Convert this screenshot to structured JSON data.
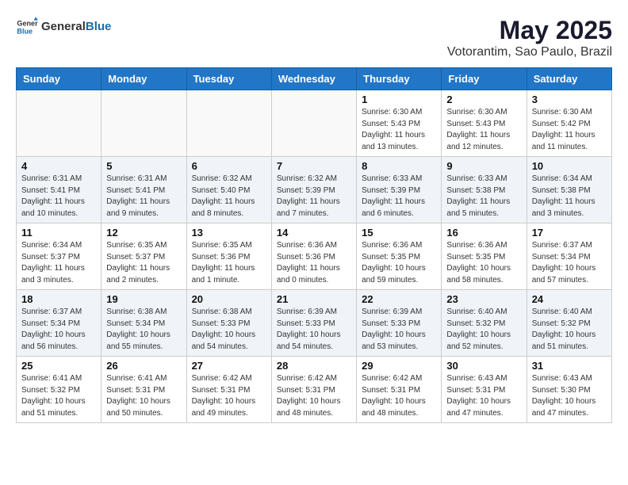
{
  "header": {
    "logo_general": "General",
    "logo_blue": "Blue",
    "title": "May 2025",
    "subtitle": "Votorantim, Sao Paulo, Brazil"
  },
  "weekdays": [
    "Sunday",
    "Monday",
    "Tuesday",
    "Wednesday",
    "Thursday",
    "Friday",
    "Saturday"
  ],
  "weeks": [
    [
      {
        "day": "",
        "info": ""
      },
      {
        "day": "",
        "info": ""
      },
      {
        "day": "",
        "info": ""
      },
      {
        "day": "",
        "info": ""
      },
      {
        "day": "1",
        "info": "Sunrise: 6:30 AM\nSunset: 5:43 PM\nDaylight: 11 hours\nand 13 minutes."
      },
      {
        "day": "2",
        "info": "Sunrise: 6:30 AM\nSunset: 5:43 PM\nDaylight: 11 hours\nand 12 minutes."
      },
      {
        "day": "3",
        "info": "Sunrise: 6:30 AM\nSunset: 5:42 PM\nDaylight: 11 hours\nand 11 minutes."
      }
    ],
    [
      {
        "day": "4",
        "info": "Sunrise: 6:31 AM\nSunset: 5:41 PM\nDaylight: 11 hours\nand 10 minutes."
      },
      {
        "day": "5",
        "info": "Sunrise: 6:31 AM\nSunset: 5:41 PM\nDaylight: 11 hours\nand 9 minutes."
      },
      {
        "day": "6",
        "info": "Sunrise: 6:32 AM\nSunset: 5:40 PM\nDaylight: 11 hours\nand 8 minutes."
      },
      {
        "day": "7",
        "info": "Sunrise: 6:32 AM\nSunset: 5:39 PM\nDaylight: 11 hours\nand 7 minutes."
      },
      {
        "day": "8",
        "info": "Sunrise: 6:33 AM\nSunset: 5:39 PM\nDaylight: 11 hours\nand 6 minutes."
      },
      {
        "day": "9",
        "info": "Sunrise: 6:33 AM\nSunset: 5:38 PM\nDaylight: 11 hours\nand 5 minutes."
      },
      {
        "day": "10",
        "info": "Sunrise: 6:34 AM\nSunset: 5:38 PM\nDaylight: 11 hours\nand 3 minutes."
      }
    ],
    [
      {
        "day": "11",
        "info": "Sunrise: 6:34 AM\nSunset: 5:37 PM\nDaylight: 11 hours\nand 3 minutes."
      },
      {
        "day": "12",
        "info": "Sunrise: 6:35 AM\nSunset: 5:37 PM\nDaylight: 11 hours\nand 2 minutes."
      },
      {
        "day": "13",
        "info": "Sunrise: 6:35 AM\nSunset: 5:36 PM\nDaylight: 11 hours\nand 1 minute."
      },
      {
        "day": "14",
        "info": "Sunrise: 6:36 AM\nSunset: 5:36 PM\nDaylight: 11 hours\nand 0 minutes."
      },
      {
        "day": "15",
        "info": "Sunrise: 6:36 AM\nSunset: 5:35 PM\nDaylight: 10 hours\nand 59 minutes."
      },
      {
        "day": "16",
        "info": "Sunrise: 6:36 AM\nSunset: 5:35 PM\nDaylight: 10 hours\nand 58 minutes."
      },
      {
        "day": "17",
        "info": "Sunrise: 6:37 AM\nSunset: 5:34 PM\nDaylight: 10 hours\nand 57 minutes."
      }
    ],
    [
      {
        "day": "18",
        "info": "Sunrise: 6:37 AM\nSunset: 5:34 PM\nDaylight: 10 hours\nand 56 minutes."
      },
      {
        "day": "19",
        "info": "Sunrise: 6:38 AM\nSunset: 5:34 PM\nDaylight: 10 hours\nand 55 minutes."
      },
      {
        "day": "20",
        "info": "Sunrise: 6:38 AM\nSunset: 5:33 PM\nDaylight: 10 hours\nand 54 minutes."
      },
      {
        "day": "21",
        "info": "Sunrise: 6:39 AM\nSunset: 5:33 PM\nDaylight: 10 hours\nand 54 minutes."
      },
      {
        "day": "22",
        "info": "Sunrise: 6:39 AM\nSunset: 5:33 PM\nDaylight: 10 hours\nand 53 minutes."
      },
      {
        "day": "23",
        "info": "Sunrise: 6:40 AM\nSunset: 5:32 PM\nDaylight: 10 hours\nand 52 minutes."
      },
      {
        "day": "24",
        "info": "Sunrise: 6:40 AM\nSunset: 5:32 PM\nDaylight: 10 hours\nand 51 minutes."
      }
    ],
    [
      {
        "day": "25",
        "info": "Sunrise: 6:41 AM\nSunset: 5:32 PM\nDaylight: 10 hours\nand 51 minutes."
      },
      {
        "day": "26",
        "info": "Sunrise: 6:41 AM\nSunset: 5:31 PM\nDaylight: 10 hours\nand 50 minutes."
      },
      {
        "day": "27",
        "info": "Sunrise: 6:42 AM\nSunset: 5:31 PM\nDaylight: 10 hours\nand 49 minutes."
      },
      {
        "day": "28",
        "info": "Sunrise: 6:42 AM\nSunset: 5:31 PM\nDaylight: 10 hours\nand 48 minutes."
      },
      {
        "day": "29",
        "info": "Sunrise: 6:42 AM\nSunset: 5:31 PM\nDaylight: 10 hours\nand 48 minutes."
      },
      {
        "day": "30",
        "info": "Sunrise: 6:43 AM\nSunset: 5:31 PM\nDaylight: 10 hours\nand 47 minutes."
      },
      {
        "day": "31",
        "info": "Sunrise: 6:43 AM\nSunset: 5:30 PM\nDaylight: 10 hours\nand 47 minutes."
      }
    ]
  ]
}
